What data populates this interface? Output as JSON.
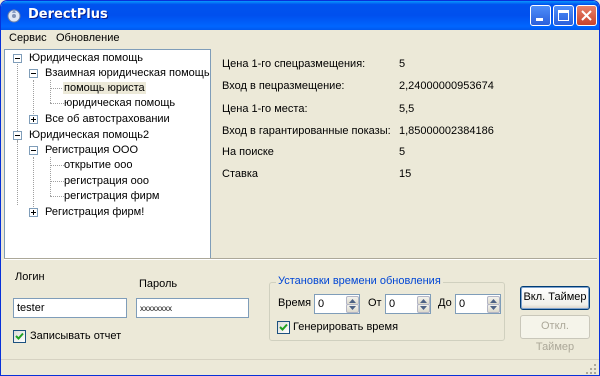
{
  "window": {
    "title": "DerectPlus"
  },
  "menu": {
    "items": [
      "Сервис",
      "Обновление"
    ]
  },
  "tree": {
    "nodes": [
      {
        "label": "Юридическая помощь"
      },
      {
        "label": "Взаимная юридическая помощь"
      },
      {
        "label": "помощь юриста",
        "selected": true
      },
      {
        "label": "юридическая помощь"
      },
      {
        "label": "Все об автостраховании"
      },
      {
        "label": "Юридическая помощь2"
      },
      {
        "label": "Регистрация ООО"
      },
      {
        "label": "открытие ооо"
      },
      {
        "label": "регистрация ооо"
      },
      {
        "label": "регистрация фирм"
      },
      {
        "label": "Регистрация фирм!"
      }
    ]
  },
  "info": {
    "rows": [
      {
        "label": "Цена 1-го спецразмещения:",
        "value": "5"
      },
      {
        "label": "Вход в пецразмещение:",
        "value": "2,24000000953674"
      },
      {
        "label": "Цена 1-го места:",
        "value": "5,5"
      },
      {
        "label": "Вход в гарантированные показы:",
        "value": "1,85000002384186"
      },
      {
        "label": "На поиске",
        "value": "5"
      },
      {
        "label": "Ставка",
        "value": "15"
      }
    ]
  },
  "login": {
    "label": "Логин",
    "value": "tester"
  },
  "password": {
    "label": "Пароль",
    "value": "xxxxxxxx"
  },
  "log_checkbox": {
    "label": "Записывать отчет",
    "checked": true
  },
  "update_group": {
    "title": "Установки времени обновления",
    "time_label": "Время",
    "time_value": "0",
    "from_label": "От",
    "from_value": "0",
    "to_label": "До",
    "to_value": "0",
    "generate_label": "Генерировать время",
    "generate_checked": true
  },
  "buttons": {
    "timer_on": "Вкл. Таймер",
    "timer_off": "Откл. Таймер"
  },
  "colors": {
    "titlebar": "#0058ee",
    "face": "#ece9d8",
    "group_title": "#0046d5"
  }
}
